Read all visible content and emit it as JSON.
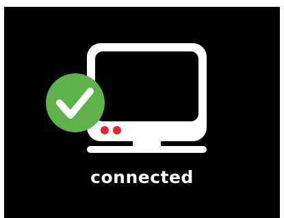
{
  "status": {
    "text": "connected",
    "state_icon": "check-icon",
    "device_icon": "monitor-icon"
  },
  "colors": {
    "background": "#000000",
    "monitor": "#ffffff",
    "success": "#5fb14a",
    "indicator_led": "#e3242b"
  }
}
